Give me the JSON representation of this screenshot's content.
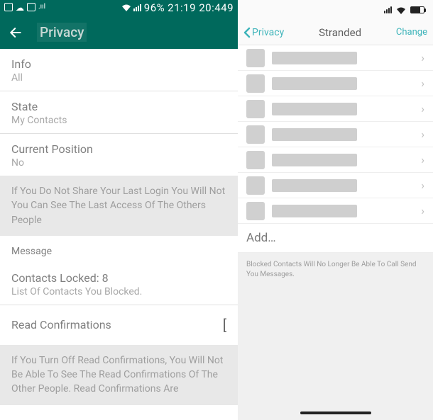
{
  "android_statusbar": {
    "battery_text": "96%",
    "time": "21:19 20:449"
  },
  "android_header": {
    "title": "Privacy"
  },
  "settings": {
    "info": {
      "title": "Info",
      "value": "All"
    },
    "state": {
      "title": "State",
      "value": "My Contacts"
    },
    "position": {
      "title": "Current Position",
      "value": "No"
    },
    "note_last_login": "If You Do Not Share Your Last Login You Will Not You Can See The Last Access Of The Others People",
    "message_label": "Message",
    "blocked": {
      "title": "Contacts Locked: 8",
      "value": "List Of Contacts You Blocked."
    },
    "read": {
      "title": "Read Confirmations"
    },
    "note_read": "If You Turn Off Read Confirmations, You Will Not Be Able To See The Read Confirmations Of The Other People. Read Confirmations Are"
  },
  "ios_nav": {
    "back": "Privacy",
    "title": "Stranded",
    "change": "Change"
  },
  "ios_list_count": 7,
  "ios_add": "Add…",
  "ios_footer": "Blocked Contacts Will No Longer Be Able To Call Send You Messages."
}
